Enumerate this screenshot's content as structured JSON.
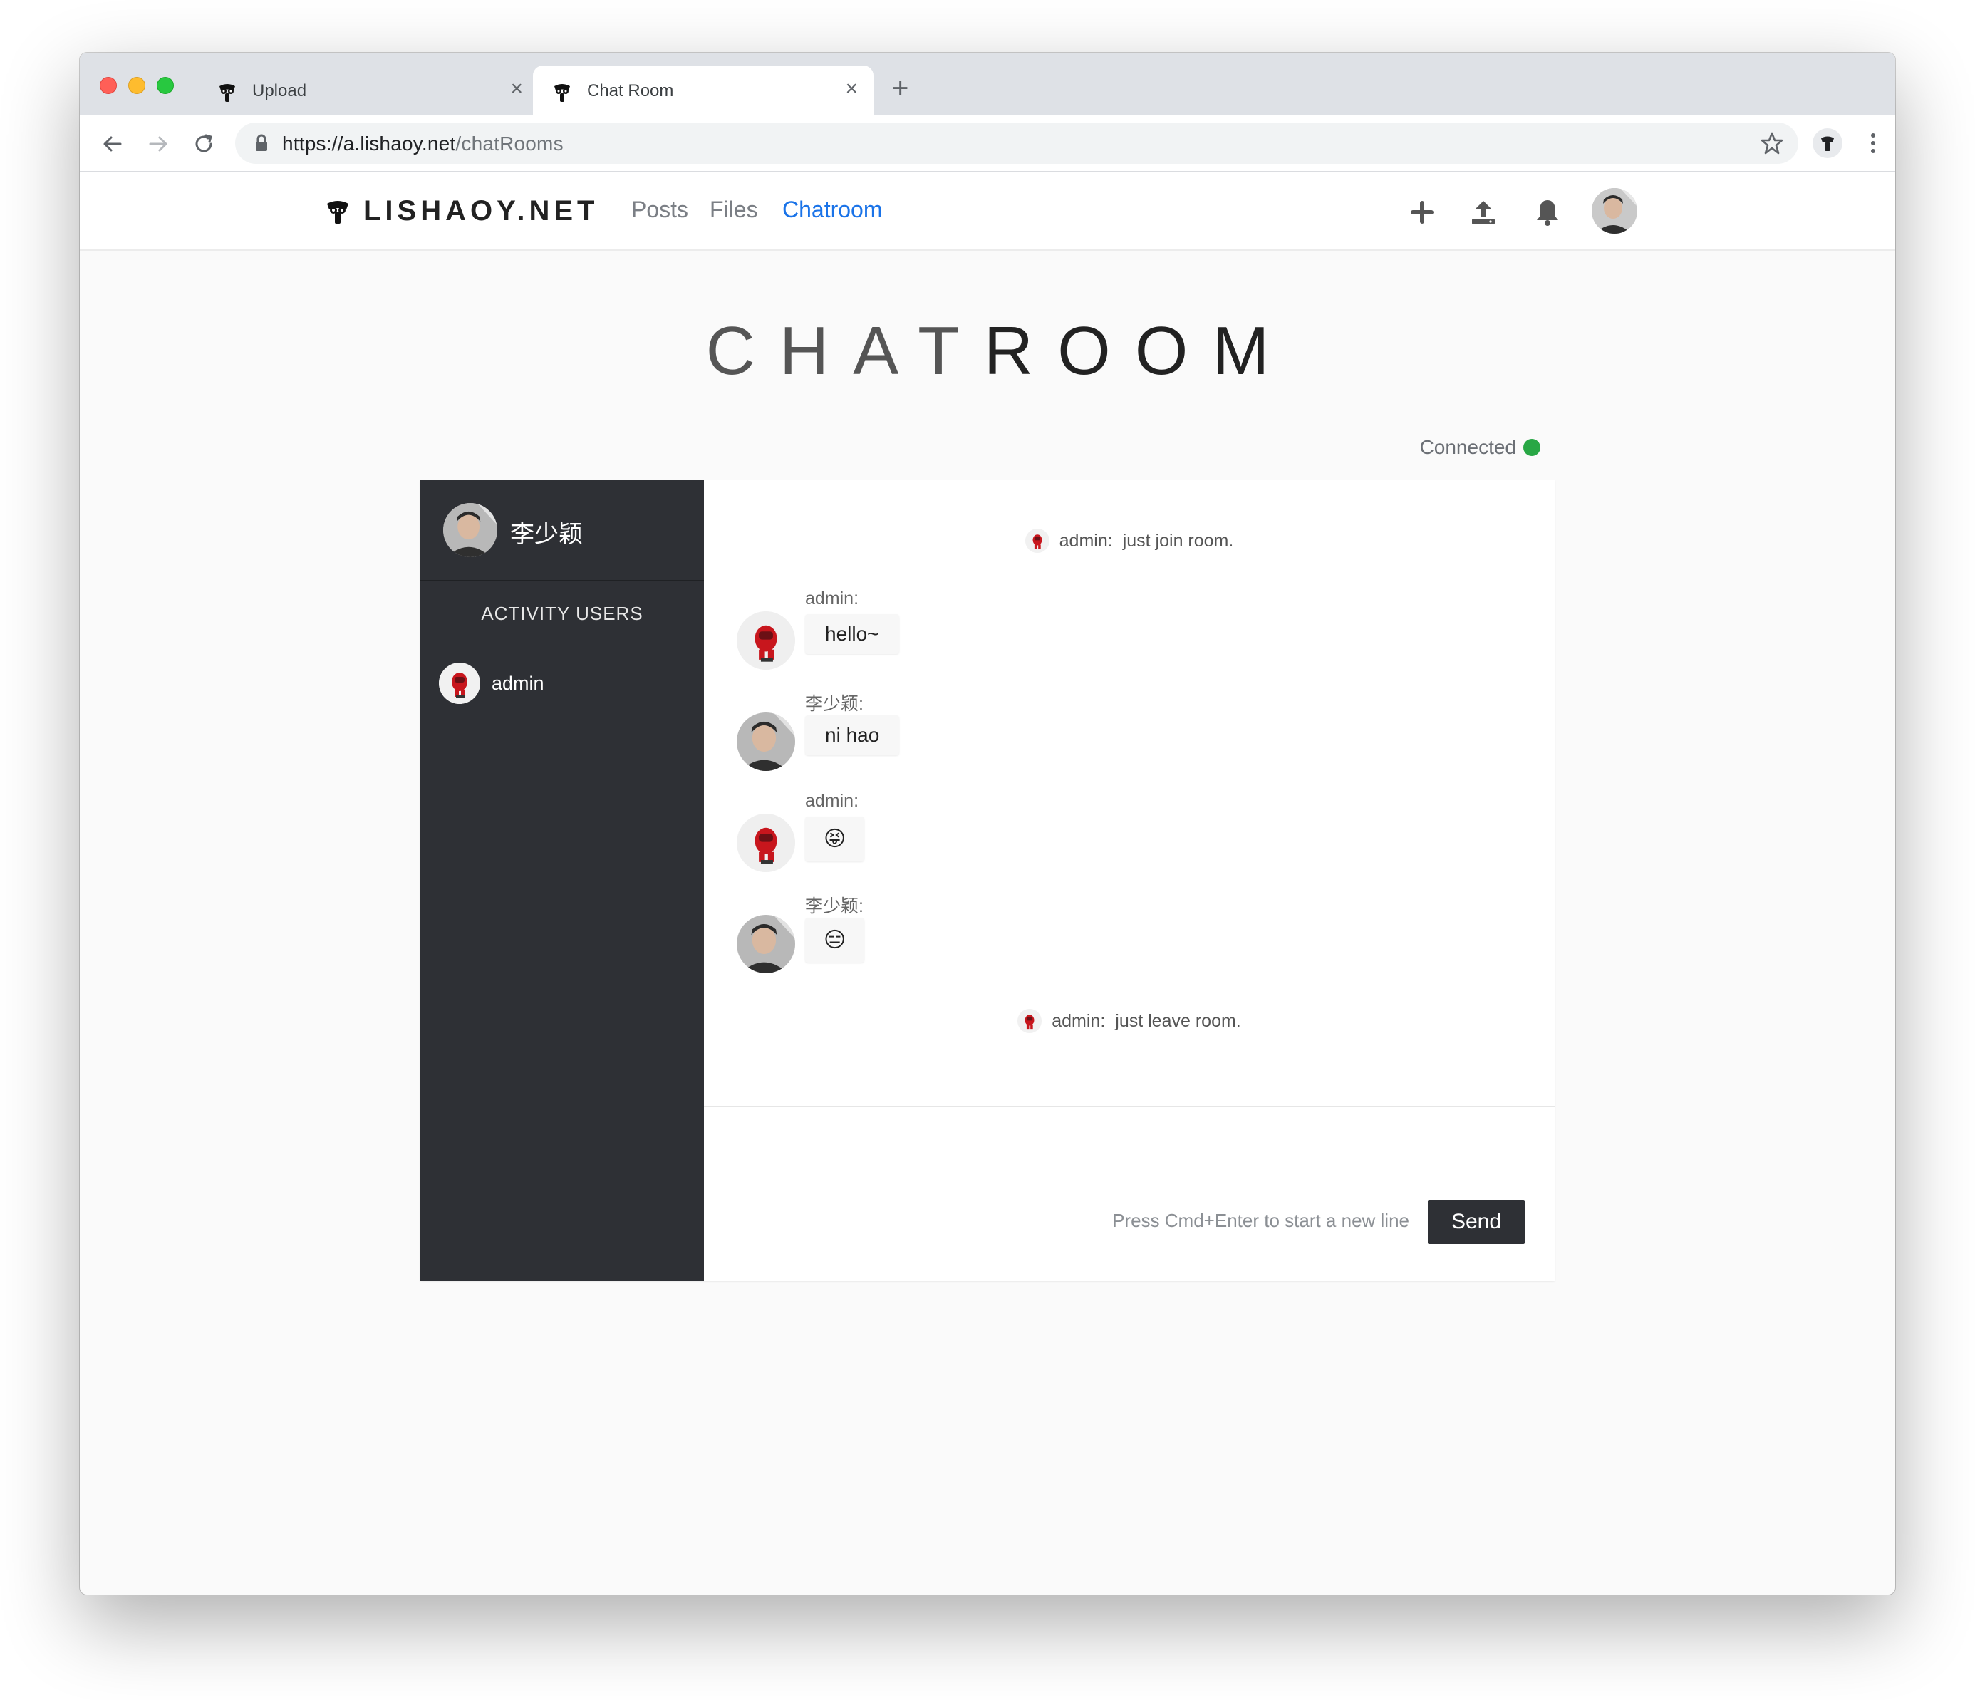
{
  "browser": {
    "tabs": [
      {
        "title": "Upload",
        "active": false
      },
      {
        "title": "Chat Room",
        "active": true
      }
    ],
    "url_host": "https://a.lishaoy.net",
    "url_path": "/chatRooms"
  },
  "site": {
    "brand": "LISHAOY.NET",
    "nav": [
      {
        "label": "Posts",
        "active": false
      },
      {
        "label": "Files",
        "active": false
      },
      {
        "label": "Chatroom",
        "active": true
      }
    ]
  },
  "page": {
    "title_part1": "CHAT",
    "title_part2": "ROOM",
    "connection_status": "Connected"
  },
  "sidebar": {
    "current_user": "李少颖",
    "heading": "ACTIVITY USERS",
    "users": [
      {
        "name": "admin"
      }
    ]
  },
  "messages": [
    {
      "type": "system",
      "user": "admin:",
      "text": "just join room."
    },
    {
      "type": "chat",
      "user": "admin:",
      "text": "hello~",
      "avatar": "robot"
    },
    {
      "type": "chat",
      "user": "李少颖:",
      "text": "ni hao",
      "avatar": "person"
    },
    {
      "type": "chat",
      "user": "admin:",
      "text": "😝",
      "avatar": "robot"
    },
    {
      "type": "chat",
      "user": "李少颖:",
      "text": "😑",
      "avatar": "person"
    },
    {
      "type": "system",
      "user": "admin:",
      "text": "just leave room."
    }
  ],
  "composer": {
    "hint": "Press Cmd+Enter to start a new line",
    "send_label": "Send",
    "value": ""
  },
  "colors": {
    "accent": "#1a73e8",
    "status_connected": "#28a745",
    "sidebar_bg": "#2e3035"
  }
}
